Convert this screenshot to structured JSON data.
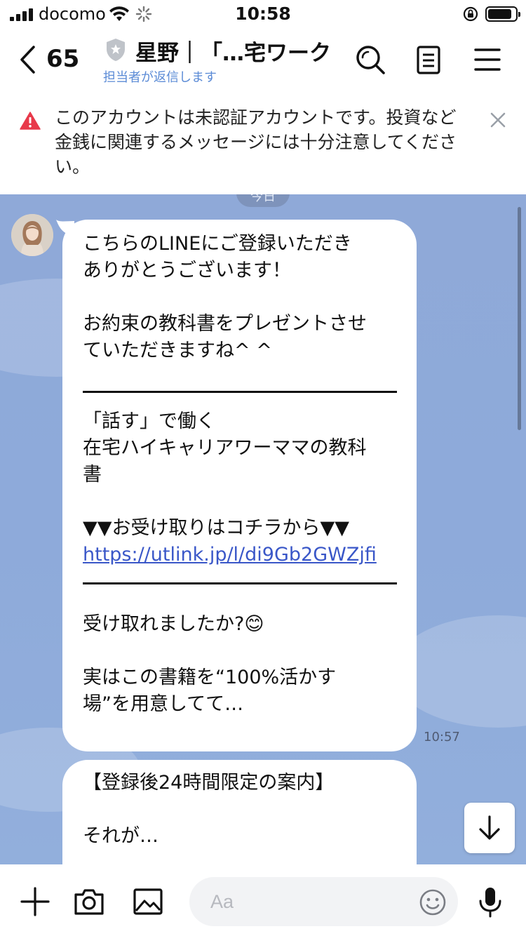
{
  "status_bar": {
    "carrier": "docomo",
    "time": "10:58"
  },
  "header": {
    "back_count": "65",
    "title": "星野｜「…宅ワーク",
    "subtitle": "担当者が返信します"
  },
  "warning": {
    "text": "このアカウントは未認証アカウントです。投資など金銭に関連するメッセージには十分注意してください。"
  },
  "chat": {
    "date_pill": "今日",
    "messages": [
      {
        "para1": "こちらのLINEにご登録いただき\nありがとうございます！",
        "para2": "お約束の教科書をプレゼントさせ\nていただきますね^ ^",
        "book_title": "「話す」で働く\n在宅ハイキャリアワーママの教科\n書",
        "receive_label": "▼▼お受け取りはコチラから▼▼",
        "link": "https://utlink.jp/l/di9Gb2GWZjfi",
        "question": "受け取れましたか?😊",
        "para3": "実はこの書籍を“100%活かす\n場”を用意してて…",
        "time": "10:57"
      },
      {
        "line1": "【登録後24時間限定の案内】",
        "line2": "それが…"
      }
    ]
  },
  "input_bar": {
    "placeholder": "Aa"
  },
  "colors": {
    "chat_background": "#8fa9d8",
    "link": "#3a57c8",
    "warning_red": "#e8394a",
    "subtitle_blue": "#5b8bd6"
  },
  "icons": [
    "signal-icon",
    "wifi-icon",
    "loading-icon",
    "rotation-lock-icon",
    "battery-icon",
    "back-chevron-icon",
    "shield-icon",
    "search-icon",
    "notes-icon",
    "menu-icon",
    "warning-icon",
    "close-icon",
    "arrow-down-icon",
    "plus-icon",
    "camera-icon",
    "image-icon",
    "emoji-icon",
    "microphone-icon"
  ]
}
